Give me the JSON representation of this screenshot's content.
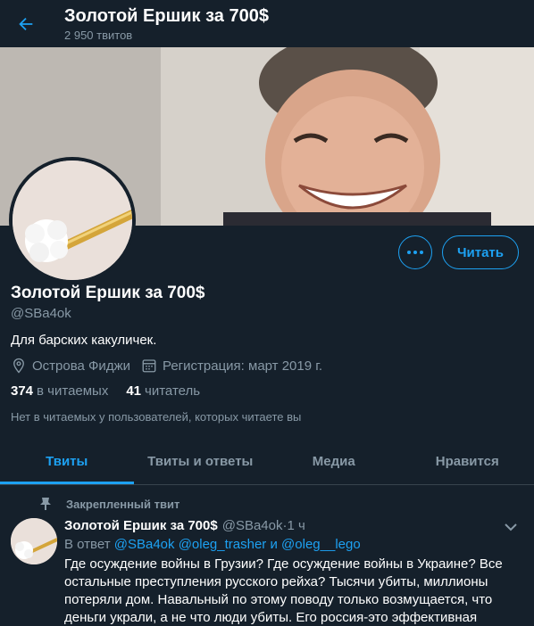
{
  "header": {
    "title": "Золотой Ершик за 700$",
    "tweet_count": "2 950 твитов"
  },
  "profile": {
    "name": "Золотой Ершик за 700$",
    "handle": "@SBa4ok",
    "bio": "Для барских какуличек.",
    "location": "Острова Фиджи",
    "joined": "Регистрация: март 2019 г.",
    "following_count": "374",
    "following_label": "в читаемых",
    "followers_count": "41",
    "followers_label": "читатель",
    "not_followed_note": "Нет в читаемых у пользователей, которых читаете вы",
    "follow_button": "Читать"
  },
  "tabs": [
    {
      "label": "Твиты",
      "active": true
    },
    {
      "label": "Твиты и ответы",
      "active": false
    },
    {
      "label": "Медиа",
      "active": false
    },
    {
      "label": "Нравится",
      "active": false
    }
  ],
  "tweet": {
    "pinned_label": "Закрепленный твит",
    "name": "Золотой Ершик за 700$",
    "handle": "@SBa4ok",
    "separator": " · ",
    "time": "1 ч",
    "reply_prefix": "В ответ",
    "reply_user1": "@SBa4ok",
    "reply_user2": "@oleg_trasher",
    "reply_and": "и",
    "reply_user3": "@oleg__lego",
    "text": "Где осуждение войны в Грузии? Где осуждение войны в Украине? Все остальные преступления русского рейха? Тысячи убиты, миллионы потеряли дом. Навальный по этому поводу только возмущается, что деньги украли, а не что люди убиты. Его россия-это эффективная"
  },
  "colors": {
    "background": "#15202b",
    "accent": "#1da1f2",
    "secondary_text": "#8899a6",
    "border": "#38444d"
  },
  "icons": [
    "back-arrow-icon",
    "more-dots-icon",
    "location-icon",
    "calendar-icon",
    "pin-icon",
    "chevron-down-icon"
  ]
}
